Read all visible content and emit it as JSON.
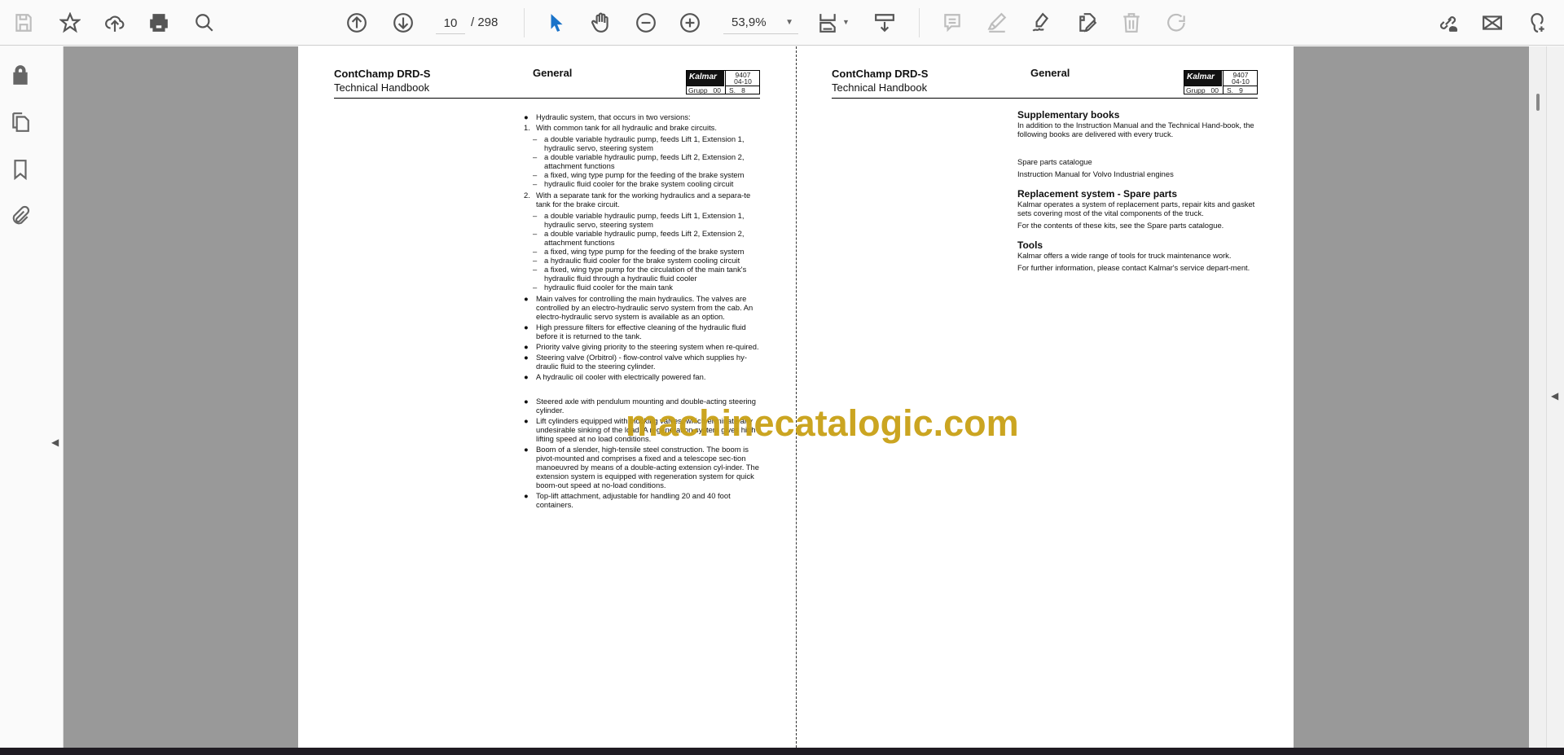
{
  "toolbar": {
    "icons": [
      "save-icon",
      "bookmark-star-icon",
      "upload-cloud-icon",
      "print-icon",
      "search-icon",
      "page-up-icon",
      "page-down-icon",
      "select-cursor-icon",
      "hand-icon",
      "zoom-out-icon",
      "zoom-in-icon",
      "fit-page-icon",
      "scroll-mode-icon",
      "comment-icon",
      "highlight-icon",
      "sign-icon",
      "edit-pdf-icon",
      "delete-icon",
      "rotate-icon",
      "share-link-icon",
      "email-icon",
      "add-user-icon"
    ],
    "current_page": "10",
    "total_pages": "/ 298",
    "zoom_level": "53,9%",
    "accent_color": "#1a73c9"
  },
  "left_rail": {
    "icons": [
      "lock-icon",
      "pages-icon",
      "bookmark-icon",
      "attachment-icon"
    ]
  },
  "pages": {
    "left": {
      "title": "ContChamp DRD-S",
      "subtitle": "Technical Handbook",
      "section": "General",
      "logo_text": "Kalmar",
      "doc_no": "9407",
      "doc_date": "04-10",
      "group_label": "Grupp",
      "group_no": "00",
      "page_label": "S.",
      "page_no": "8",
      "items": [
        {
          "m": "●",
          "t": "Hydraulic system, that occurs in two versions:"
        },
        {
          "m": "1.",
          "t": "With common tank for all hydraulic and brake circuits.",
          "subs": [
            "a double variable hydraulic pump, feeds Lift 1, Extension 1, hydraulic servo, steering system",
            "a double variable hydraulic pump, feeds Lift 2, Extension 2, attachment functions",
            "a fixed, wing type pump for the feeding of the brake system",
            "hydraulic fluid cooler for the brake system cooling circuit"
          ]
        },
        {
          "m": "2.",
          "t": "With a separate tank for the working hydraulics and a separa-te tank for the brake circuit.",
          "subs": [
            "a double variable hydraulic pump, feeds Lift 1, Extension 1, hydraulic servo, steering system",
            "a double variable hydraulic pump, feeds Lift 2, Extension 2, attachment functions",
            "a fixed, wing type pump for the feeding of the brake system",
            "a hydraulic fluid cooler for the brake system cooling circuit",
            "a fixed, wing type pump for the circulation of the main tank's hydraulic fluid through a hydraulic fluid cooler",
            "hydraulic fluid cooler for the main tank"
          ]
        },
        {
          "m": "●",
          "t": "Main valves for controlling the main hydraulics. The valves are controlled by an electro-hydraulic servo system from the cab. An electro-hydraulic servo system is available as an option."
        },
        {
          "m": "●",
          "t": "High pressure filters for effective cleaning of the hydraulic fluid before it is returned to the tank."
        },
        {
          "m": "●",
          "t": "Priority valve giving priority to the steering system when re-quired."
        },
        {
          "m": "●",
          "t": "Steering valve (Orbitrol) - flow-control valve which supplies hy-draulic fluid to the steering cylinder."
        },
        {
          "m": "●",
          "t": "A hydraulic oil cooler with electrically powered fan.",
          "gap": true
        },
        {
          "m": "●",
          "t": "Steered axle with pendulum mounting and double-acting steering cylinder."
        },
        {
          "m": "●",
          "t": "Lift cylinders equipped with blocking valves, which eliminate any undesirable sinking of the load. A regeneration system gives high lifting speed at no load conditions."
        },
        {
          "m": "●",
          "t": "Boom of a slender, high-tensile steel construction. The boom is pivot-mounted and comprises a fixed and a telescope sec-tion manoeuvred by means of a double-acting extension cyl-inder. The extension system is equipped with regeneration system for quick boom-out speed at no-load conditions."
        },
        {
          "m": "●",
          "t": "Top-lift attachment, adjustable for handling 20 and 40 foot containers."
        }
      ],
      "dash": "–"
    },
    "right": {
      "title": "ContChamp DRD-S",
      "subtitle": "Technical Handbook",
      "section": "General",
      "logo_text": "Kalmar",
      "doc_no": "9407",
      "doc_date": "04-10",
      "group_label": "Grupp",
      "group_no": "00",
      "page_label": "S.",
      "page_no": "9",
      "supp_heading": "Supplementary books",
      "supp_text": "In addition to the Instruction Manual and the Technical Hand-book, the following books are delivered with every truck.",
      "supp_book1": "Spare parts catalogue",
      "supp_book2": "Instruction Manual for Volvo Industrial engines",
      "repl_heading": "Replacement system - Spare parts",
      "repl_text1": "Kalmar operates a system of replacement parts, repair kits and gasket sets covering most of the vital components of the truck.",
      "repl_text2": "For the contents of these kits, see the Spare parts catalogue.",
      "tools_heading": "Tools",
      "tools_text1": "Kalmar offers a wide range of tools for truck maintenance work.",
      "tools_text2": "For further information, please contact Kalmar's service depart-ment."
    }
  },
  "watermark": "machinecatalogic.com",
  "watermark_color": "#c9a116"
}
